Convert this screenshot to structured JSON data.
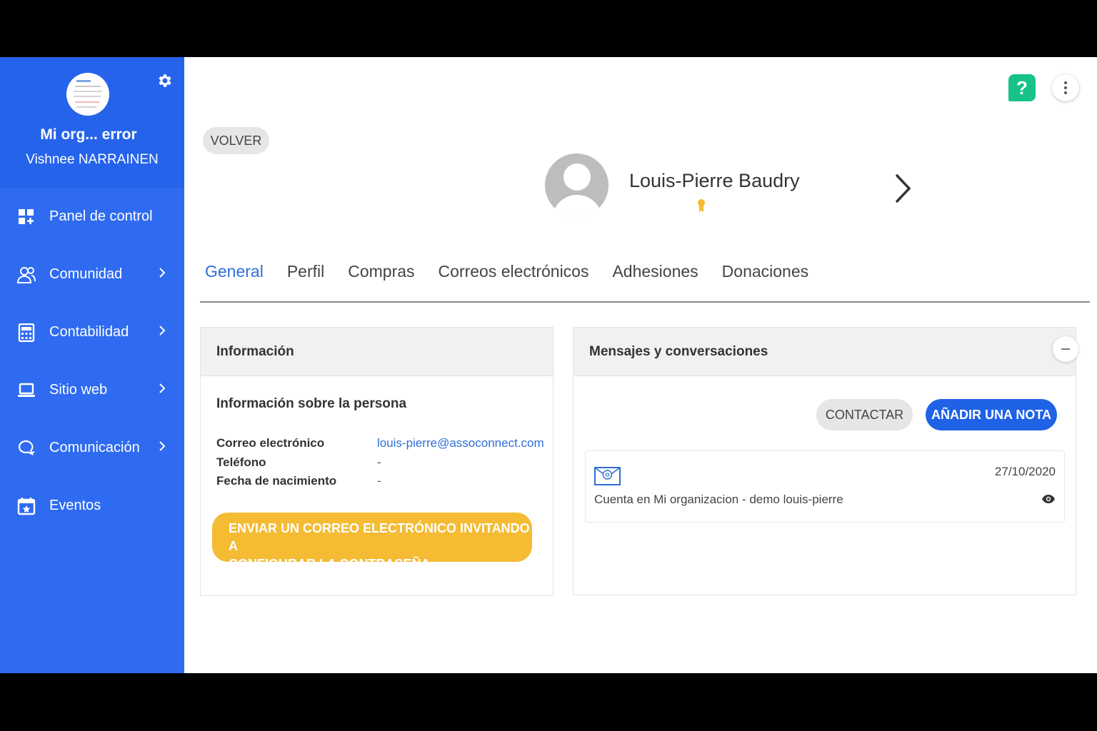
{
  "sidebar": {
    "org_name": "Mi org... error",
    "user_name": "Vishnee NARRAINEN",
    "items": [
      {
        "label": "Panel de control",
        "icon": "dashboard-icon"
      },
      {
        "label": "Comunidad",
        "icon": "community-icon"
      },
      {
        "label": "Contabilidad",
        "icon": "calculator-icon"
      },
      {
        "label": "Sitio web",
        "icon": "laptop-icon"
      },
      {
        "label": "Comunicación",
        "icon": "chat-icon"
      },
      {
        "label": "Eventos",
        "icon": "calendar-icon"
      }
    ]
  },
  "header": {
    "help_label": "?",
    "back_label": "VOLVER",
    "person_name": "Louis-Pierre Baudry"
  },
  "tabs": [
    {
      "label": "General",
      "active": true
    },
    {
      "label": "Perfil"
    },
    {
      "label": "Compras"
    },
    {
      "label": "Correos electrónicos"
    },
    {
      "label": "Adhesiones"
    },
    {
      "label": "Donaciones"
    }
  ],
  "info_card": {
    "title": "Información",
    "subtitle": "Información sobre la persona",
    "fields": [
      {
        "label": "Correo electrónico",
        "value": "louis-pierre@assoconnect.com"
      },
      {
        "label": "Teléfono",
        "value": "-"
      },
      {
        "label": "Fecha de nacimiento",
        "value": "-"
      }
    ],
    "invite_button_line1": "ENVIAR UN CORREO ELECTRÓNICO INVITANDO A",
    "invite_button_line2": "CONFIGURAR LA CONTRASEÑA"
  },
  "messages_card": {
    "title": "Mensajes y conversaciones",
    "contact_label": "CONTACTAR",
    "add_note_label": "AÑADIR UNA NOTA",
    "messages": [
      {
        "date": "27/10/2020",
        "text": "Cuenta en Mi organizacion - demo louis-pierre"
      }
    ]
  },
  "colors": {
    "sidebar": "#2f6bf0",
    "accent": "#2e6ed8",
    "invite_button": "#f4bb33",
    "help_button": "#16c28a"
  }
}
